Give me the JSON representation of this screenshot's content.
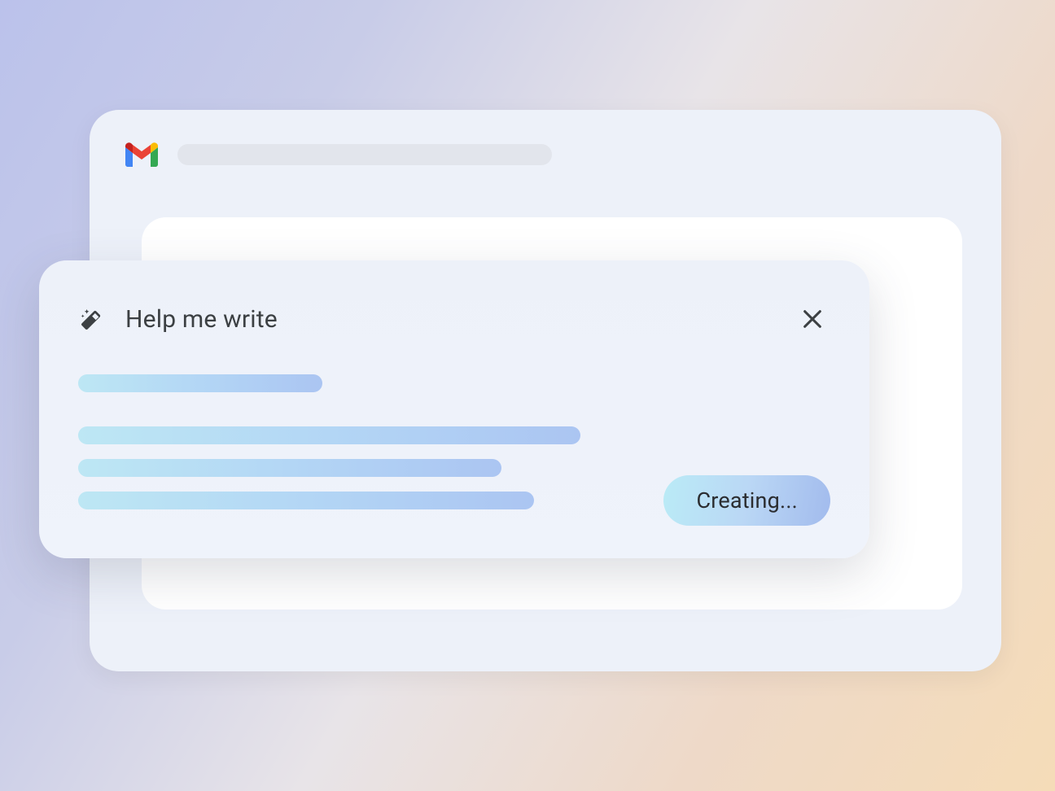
{
  "panel": {
    "title": "Help me write",
    "status_button_label": "Creating..."
  },
  "icons": {
    "magic_name": "magic-wand-icon",
    "close_name": "close-icon",
    "gmail_name": "gmail-logo-icon"
  }
}
